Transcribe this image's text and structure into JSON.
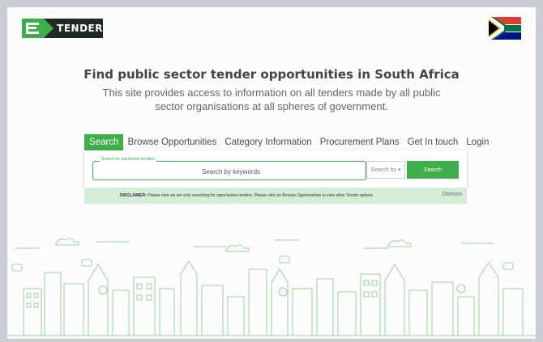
{
  "header": {
    "logo_text": "TENDER"
  },
  "hero": {
    "title": "Find public sector tender opportunities in South Africa",
    "line1": "This site provides access to information on all tenders made by all public",
    "line2": "sector organisations at all spheres of government."
  },
  "tabs": [
    {
      "label": "Search",
      "active": true
    },
    {
      "label": "Browse Opportunities"
    },
    {
      "label": "Category Information"
    },
    {
      "label": "Procurement Plans"
    },
    {
      "label": "Get In touch"
    },
    {
      "label": "Login"
    }
  ],
  "search": {
    "legend": "Search for advertised tenders",
    "placeholder": "Search by keywords",
    "search_by": "Search by",
    "button": "Search"
  },
  "disclaimer": {
    "label": "DISCLAIMER:",
    "text": " Please note we are only searching for open/active tenders. Please click on Browse Opportunities to view other Tender options",
    "dismiss": "Dismiss"
  },
  "colors": {
    "brand": "#3dae49",
    "dark": "#1f2a24"
  }
}
